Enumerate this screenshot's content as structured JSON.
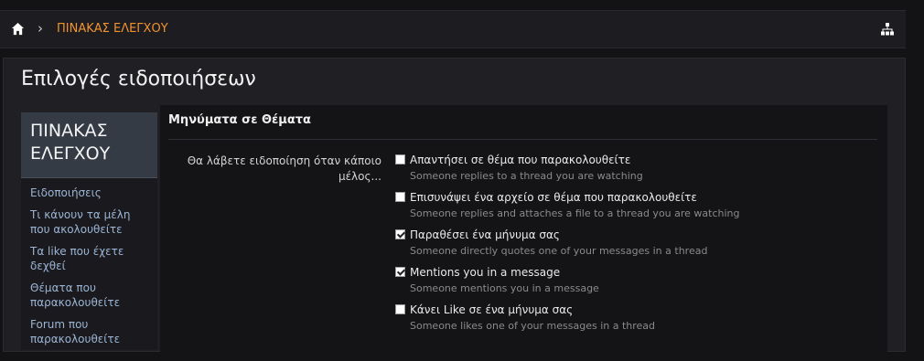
{
  "breadcrumb": {
    "current": "ΠΙΝΑΚΑΣ ΕΛΕΓΧΟΥ",
    "separator": "›"
  },
  "page": {
    "title": "Επιλογές ειδοποιήσεων"
  },
  "sidebar": {
    "heading": "ΠΙΝΑΚΑΣ ΕΛΕΓΧΟΥ",
    "items": [
      {
        "label": "Ειδοποιήσεις"
      },
      {
        "label": "Τι κάνουν τα μέλη που ακολουθείτε"
      },
      {
        "label": "Τα like που έχετε δεχθεί"
      },
      {
        "label": "Θέματα που παρακολουθείτε"
      },
      {
        "label": "Forum που παρακολουθείτε"
      }
    ]
  },
  "section": {
    "title": "Μηνύματα σε Θέματα",
    "prompt": "Θα λάβετε ειδοποίηση όταν κάποιο μέλος...",
    "options": [
      {
        "label": "Απαντήσει σε θέμα που παρακολουθείτε",
        "hint": "Someone replies to a thread you are watching",
        "checked": false
      },
      {
        "label": "Επισυνάψει ένα αρχείο σε θέμα που παρακολουθείτε",
        "hint": "Someone replies and attaches a file to a thread you are watching",
        "checked": false
      },
      {
        "label": "Παραθέσει ένα μήνυμα σας",
        "hint": "Someone directly quotes one of your messages in a thread",
        "checked": true
      },
      {
        "label": "Mentions you in a message",
        "hint": "Someone mentions you in a message",
        "checked": true
      },
      {
        "label": "Κάνει Like σε ένα μήνυμα σας",
        "hint": "Someone likes one of your messages in a thread",
        "checked": false
      }
    ]
  },
  "icons": {
    "home": "home-icon",
    "sitemap": "sitemap-icon"
  },
  "colors": {
    "accent": "#f0922e",
    "link": "#9bb4d4"
  }
}
